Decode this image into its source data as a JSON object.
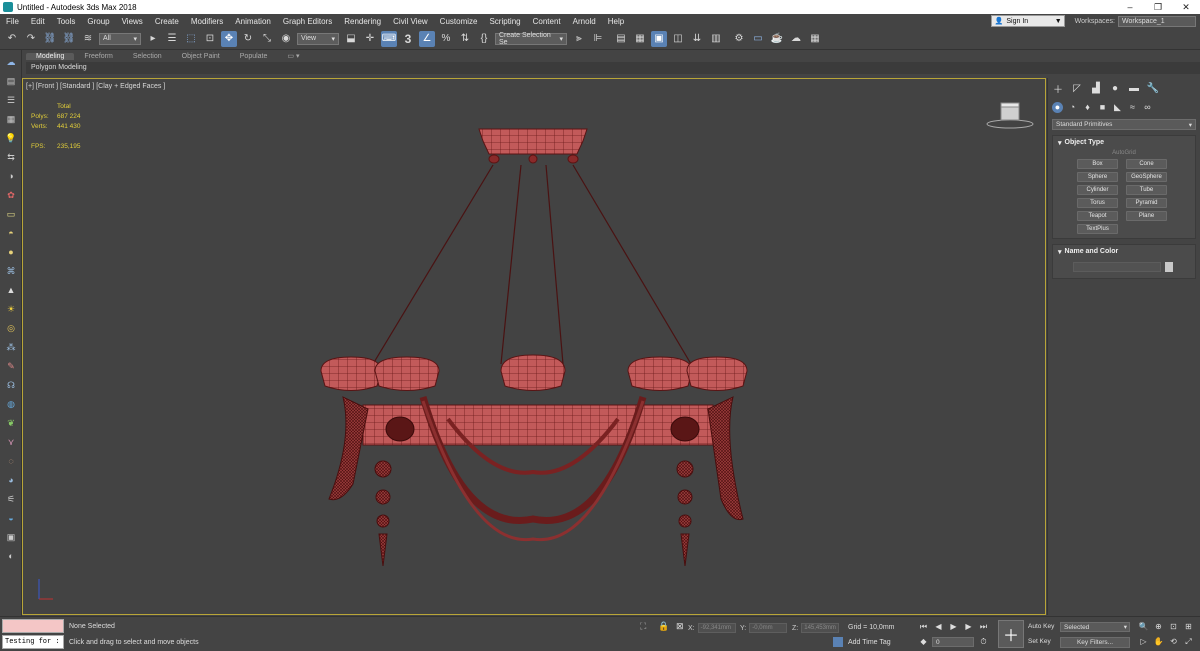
{
  "window": {
    "title": "Untitled - Autodesk 3ds Max 2018",
    "buttons": [
      "–",
      "❐",
      "✕"
    ]
  },
  "menu": [
    "File",
    "Edit",
    "Tools",
    "Group",
    "Views",
    "Create",
    "Modifiers",
    "Animation",
    "Graph Editors",
    "Rendering",
    "Civil View",
    "Customize",
    "Scripting",
    "Content",
    "Arnold",
    "Help"
  ],
  "signin": "Sign In",
  "workspaces": {
    "label": "Workspaces:",
    "value": "Workspace_1"
  },
  "toolbar": {
    "filter": "All",
    "refcoord": "View",
    "number": "3",
    "selection_set": "Create Selection Se"
  },
  "ribbon": {
    "tabs": [
      "Modeling",
      "Freeform",
      "Selection",
      "Object Paint",
      "Populate"
    ],
    "active_tab": "Modeling",
    "sub": "Polygon Modeling"
  },
  "viewport": {
    "label": "[+] [Front ] [Standard ] [Clay + Edged Faces ]",
    "stats": {
      "header": "Total",
      "polys_label": "Polys:",
      "polys": "687 224",
      "verts_label": "Verts:",
      "verts": "441 430",
      "fps_label": "FPS:",
      "fps": "235,195"
    }
  },
  "command_panel": {
    "category": "Standard Primitives",
    "object_type": {
      "title": "Object Type",
      "autogrid": "AutoGrid",
      "buttons": [
        "Box",
        "Cone",
        "Sphere",
        "GeoSphere",
        "Cylinder",
        "Tube",
        "Torus",
        "Pyramid",
        "Teapot",
        "Plane",
        "TextPlus"
      ]
    },
    "name_color": {
      "title": "Name and Color"
    }
  },
  "status": {
    "maxscript_input": "Testing for :",
    "selection": "None Selected",
    "prompt": "Click and drag to select and move objects",
    "x_label": "X:",
    "x": "-92,341mm",
    "y_label": "Y:",
    "y": "-0,0mm",
    "z_label": "Z:",
    "z": "145,453mm",
    "grid": "Grid = 10,0mm",
    "add_time_tag": "Add Time Tag",
    "frame": "0",
    "auto_key": "Auto Key",
    "set_key": "Set Key",
    "selected": "Selected",
    "key_filters": "Key Filters..."
  },
  "colors": {
    "accent": "#5a82b4",
    "viewport_border": "#b8a538",
    "stats": "#e3cf3a",
    "mesh": "#c25a5a",
    "wire": "#5a1414"
  }
}
